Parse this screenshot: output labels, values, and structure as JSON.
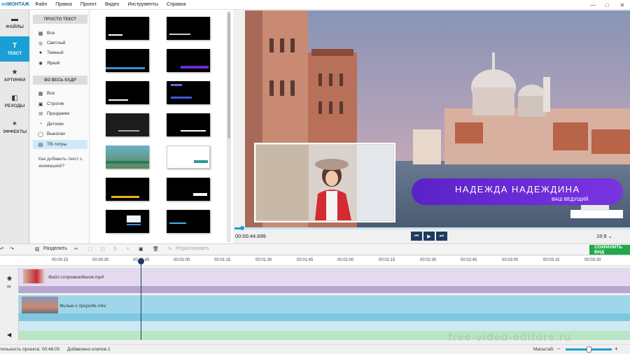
{
  "app": {
    "title_prefix": "ео",
    "title_brand": "МОНТАЖ"
  },
  "menu": [
    "Файл",
    "Правка",
    "Проект",
    "Видео",
    "Инструменты",
    "Справка"
  ],
  "window_controls": {
    "minimize": "—",
    "maximize": "□",
    "close": "✕"
  },
  "leftnav": [
    {
      "label": "ФАЙЛЫ",
      "icon": "folder-icon",
      "glyph": ""
    },
    {
      "label": "ТЕКСТ",
      "icon": "text-icon",
      "glyph": "T"
    },
    {
      "label": "АРТИНКИ",
      "icon": "star-icon",
      "glyph": "★"
    },
    {
      "label": "РЕХОДЫ",
      "icon": "transitions-icon",
      "glyph": "◧"
    },
    {
      "label": "ЭФФЕКТЫ",
      "icon": "effects-icon",
      "glyph": "✶"
    }
  ],
  "categories": {
    "group1": "ПРОСТО ТЕКСТ",
    "group1_items": [
      {
        "label": "Все",
        "icon": "grid-icon",
        "glyph": "▦"
      },
      {
        "label": "Светлый",
        "icon": "light-icon",
        "glyph": "◎"
      },
      {
        "label": "Темный",
        "icon": "dark-icon",
        "glyph": "●"
      },
      {
        "label": "Яркий",
        "icon": "bright-icon",
        "glyph": "✺"
      }
    ],
    "group2": "ВО ВЕСЬ КАДР",
    "group2_items": [
      {
        "label": "Все",
        "icon": "grid-icon",
        "glyph": "▦"
      },
      {
        "label": "Строгие",
        "icon": "strict-icon",
        "glyph": "▣"
      },
      {
        "label": "Праздники",
        "icon": "holiday-icon",
        "glyph": "✉"
      },
      {
        "label": "Детские",
        "icon": "kids-icon",
        "glyph": "◔"
      },
      {
        "label": "Выноски",
        "icon": "callout-icon",
        "glyph": "◯"
      },
      {
        "label": "ТВ-титры",
        "icon": "tv-icon",
        "glyph": "▤"
      }
    ],
    "howto": "Как добавить текст с анимацией?"
  },
  "preview": {
    "title_line": "НАДЕЖДА НАДЕЖДИНА",
    "subtitle_line": "ВАШ ВЕДУЩИЙ",
    "timecode": "00:00:44.699",
    "aspect": "16:9 ⌄",
    "progress_fraction": 0.02
  },
  "playback": {
    "prev": "⏮",
    "play": "▶",
    "next": "⏭"
  },
  "toolbar": {
    "split": "Разделить",
    "edit": "Редактировать",
    "save": "СОХРАНИТЬ ВИД"
  },
  "ruler": [
    "00:00:15",
    "00:00:30",
    "00:00:45",
    "00:01:00",
    "00:01:15",
    "00:01:30",
    "00:01:45",
    "00:02:00",
    "00:02:15",
    "00:02:30",
    "00:02:45",
    "00:03:00",
    "00:03:15",
    "00:03:30"
  ],
  "tracks": {
    "overlay_clip": "Файл сопровождения.mp4",
    "main_clip": "Фильм о природе.mkv"
  },
  "status": {
    "duration_label": "тельность проекта:",
    "duration_value": "00:46:00",
    "clips_label": "Добавлено клипов:",
    "clips_value": "1",
    "zoom_label": "Масштаб:"
  },
  "colors": {
    "accent": "#1a9fd4",
    "save": "#22a84a",
    "title_bar": "#6a2bd8"
  }
}
